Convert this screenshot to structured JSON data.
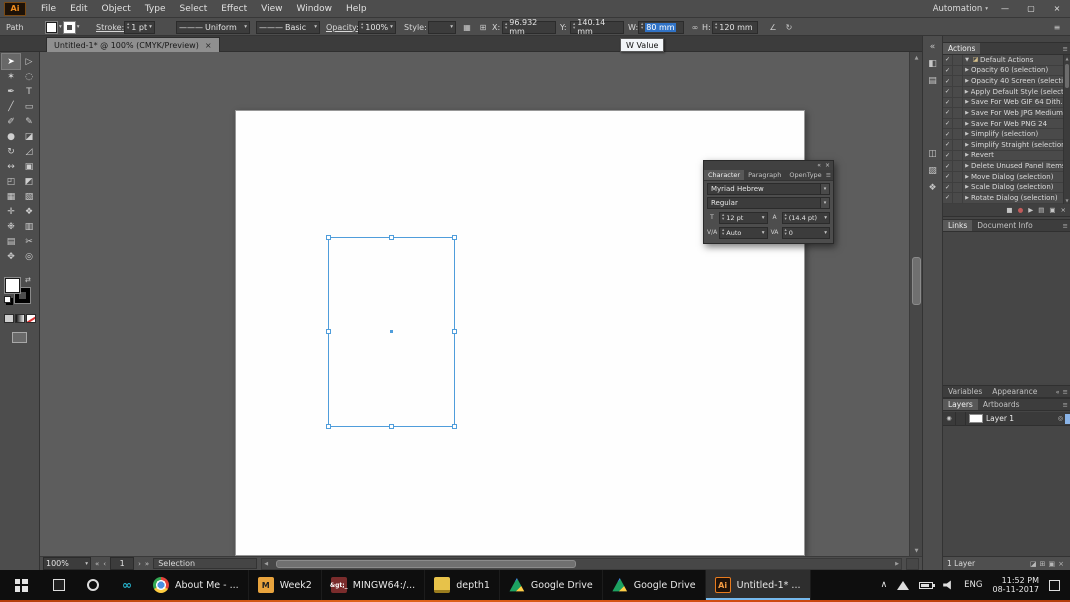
{
  "app": {
    "logo": "Ai",
    "workspace": "Automation"
  },
  "menu_bar": {
    "items": [
      "File",
      "Edit",
      "Object",
      "Type",
      "Select",
      "Effect",
      "View",
      "Window",
      "Help"
    ]
  },
  "control_bar": {
    "context_label": "Path",
    "stroke_label": "Stroke:",
    "stroke_width": "1 pt",
    "width_profile": "Uniform",
    "brush": "Basic",
    "opacity_label": "Opacity:",
    "opacity_value": "100%",
    "style_label": "Style:",
    "x_label": "X:",
    "x_value": "96.932 mm",
    "y_label": "Y:",
    "y_value": "140.14 mm",
    "w_label": "W:",
    "w_value": "80 mm",
    "h_label": "H:",
    "h_value": "120 mm"
  },
  "tooltip": {
    "text": "W Value"
  },
  "document": {
    "tab_title": "Untitled-1* @ 100% (CMYK/Preview)"
  },
  "tools": {
    "glyphs": {
      "selection": "➤",
      "direct_selection": "▷",
      "magic_wand": "✶",
      "lasso": "◌",
      "pen": "✒",
      "type": "T",
      "line": "╱",
      "rectangle": "▭",
      "paintbrush": "✐",
      "pencil": "✎",
      "blob_brush": "●",
      "eraser": "◪",
      "rotate": "↻",
      "scale": "◿",
      "width": "↔",
      "free_transform": "▣",
      "shape_builder": "◰",
      "perspective": "◩",
      "mesh": "▦",
      "gradient": "▧",
      "eyedropper": "✛",
      "blend": "❖",
      "symbol_sprayer": "❉",
      "column_graph": "▥",
      "artboard": "▤",
      "slice": "✂",
      "hand": "✥",
      "zoom": "◎"
    }
  },
  "character_panel": {
    "tab_character": "Character",
    "tab_paragraph": "Paragraph",
    "tab_opentype": "OpenType",
    "font_family": "Myriad Hebrew",
    "font_style": "Regular",
    "size_value": "12 pt",
    "leading_value": "(14.4 pt)",
    "kerning_value": "Auto",
    "tracking_value": "0"
  },
  "actions_panel": {
    "title": "Actions",
    "set_label": "Default Actions",
    "items": [
      "Opacity 60 (selection)",
      "Opacity 40 Screen (selecti...",
      "Apply Default Style (selecti...",
      "Save For Web GIF 64 Dith...",
      "Save For Web JPG Medium",
      "Save For Web PNG 24",
      "Simplify (selection)",
      "Simplify Straight (selection)",
      "Revert",
      "Delete Unused Panel Items",
      "Move Dialog (selection)",
      "Scale Dialog (selection)",
      "Rotate Dialog (selection)"
    ]
  },
  "links_panel": {
    "tab_links": "Links",
    "tab_docinfo": "Document Info"
  },
  "variables_row": {
    "tab_variables": "Variables",
    "tab_appearance": "Appearance"
  },
  "layers_panel": {
    "tab_layers": "Layers",
    "tab_artboards": "Artboards",
    "layer_name": "Layer 1",
    "status": "1 Layer"
  },
  "status_bar": {
    "zoom": "100%",
    "artboard_number": "1",
    "status": "Selection"
  },
  "taskbar": {
    "apps": [
      "About Me - ...",
      "Week2",
      "MINGW64:/...",
      "depth1",
      "Google Drive",
      "Google Drive",
      "Untitled-1* ..."
    ],
    "tray": {
      "language": "ENG",
      "time": "11:52 PM",
      "date": "08-11-2017"
    }
  },
  "icons": {
    "dropdown": "▾",
    "stepper_up": "▴",
    "stepper_down": "▾",
    "close": "×",
    "menu": "≡",
    "check": "✓",
    "expand": "▶",
    "collapse_open": "▼",
    "folder": "◪",
    "minimize": "—",
    "restore": "▢",
    "window_close": "×",
    "swap": "⇄",
    "link": "∞",
    "eye": "◉",
    "target": "◎",
    "stop": "■",
    "record": "●",
    "play": "▶",
    "new_set": "▤",
    "new_action": "▣",
    "trash": "×",
    "nav_first": "«",
    "nav_prev": "‹",
    "nav_next": "›",
    "nav_last": "»",
    "scroll_up": "▲",
    "scroll_down": "▼",
    "scroll_left": "◀",
    "scroll_right": "▶",
    "collapse_dock": "«",
    "chevron_up": "∧",
    "stroke_preview": "———",
    "font_size_icon": "T",
    "leading_icon": "A",
    "kerning_icon": "V/A",
    "tracking_icon": "VA",
    "shear_icon": "∠",
    "rotate_icon": "↻",
    "shape_props_icon": "▦",
    "align_icon": "⊞",
    "dock_icon_1": "◧",
    "dock_icon_2": "▤",
    "dock_icon_3": "◫",
    "dock_icon_4": "▨",
    "dock_icon_5": "❖",
    "mask_icon": "◪",
    "sublayer_icon": "⊞",
    "newlayer_icon": "▣",
    "dellayer_icon": "×",
    "infinity": "∞",
    "mu_logo": "M",
    "git_logo": "&gt;_"
  }
}
